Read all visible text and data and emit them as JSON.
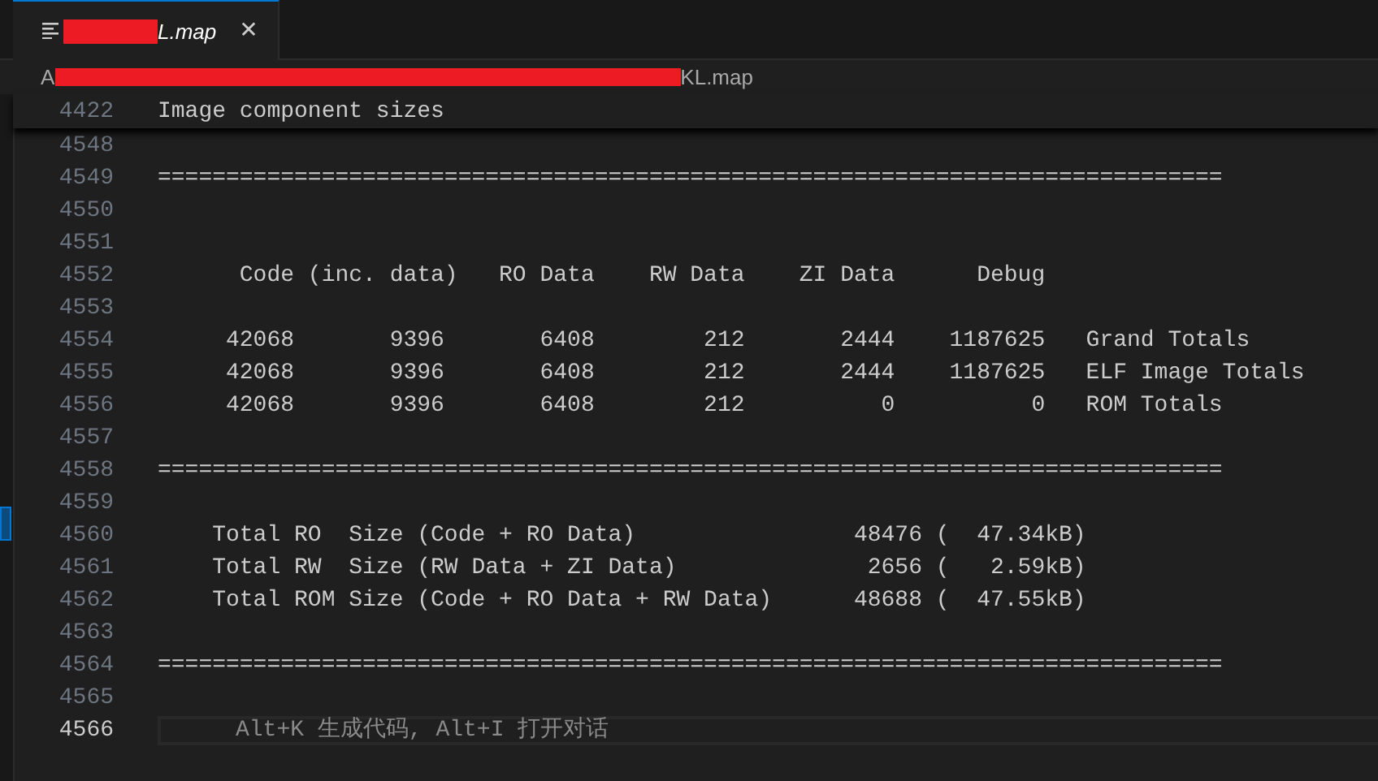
{
  "tab": {
    "title": "L.map",
    "redacted": true,
    "selected": true,
    "close": "✕"
  },
  "breadcrumb": {
    "start": "A",
    "end": "KL.map",
    "redacted": true
  },
  "sticky_line": {
    "number": "4422",
    "text": "Image component sizes"
  },
  "lines": [
    {
      "number": "4548",
      "current": false
    },
    {
      "number": "4549",
      "current": false,
      "text": "=============================================================================="
    },
    {
      "number": "4550",
      "current": false
    },
    {
      "number": "4551",
      "current": false
    },
    {
      "number": "4552",
      "current": false,
      "text": "      Code (inc. data)   RO Data    RW Data    ZI Data      Debug"
    },
    {
      "number": "4553",
      "current": false
    },
    {
      "number": "4554",
      "current": false,
      "text": "     42068       9396       6408        212       2444    1187625   Grand Totals"
    },
    {
      "number": "4555",
      "current": false,
      "text": "     42068       9396       6408        212       2444    1187625   ELF Image Totals"
    },
    {
      "number": "4556",
      "current": false,
      "text": "     42068       9396       6408        212          0          0   ROM Totals"
    },
    {
      "number": "4557",
      "current": false
    },
    {
      "number": "4558",
      "current": false,
      "text": "=============================================================================="
    },
    {
      "number": "4559",
      "current": false
    },
    {
      "number": "4560",
      "current": false,
      "text": "    Total RO  Size (Code + RO Data)                48476 (  47.34kB)"
    },
    {
      "number": "4561",
      "current": false,
      "text": "    Total RW  Size (RW Data + ZI Data)              2656 (   2.59kB)"
    },
    {
      "number": "4562",
      "current": false,
      "text": "    Total ROM Size (Code + RO Data + RW Data)      48688 (  47.55kB)"
    },
    {
      "number": "4563",
      "current": false
    },
    {
      "number": "4564",
      "current": false,
      "text": "=============================================================================="
    },
    {
      "number": "4565",
      "current": false
    },
    {
      "number": "4566",
      "current": true,
      "hint": "Alt+K 生成代码, Alt+I 打开对话"
    }
  ]
}
